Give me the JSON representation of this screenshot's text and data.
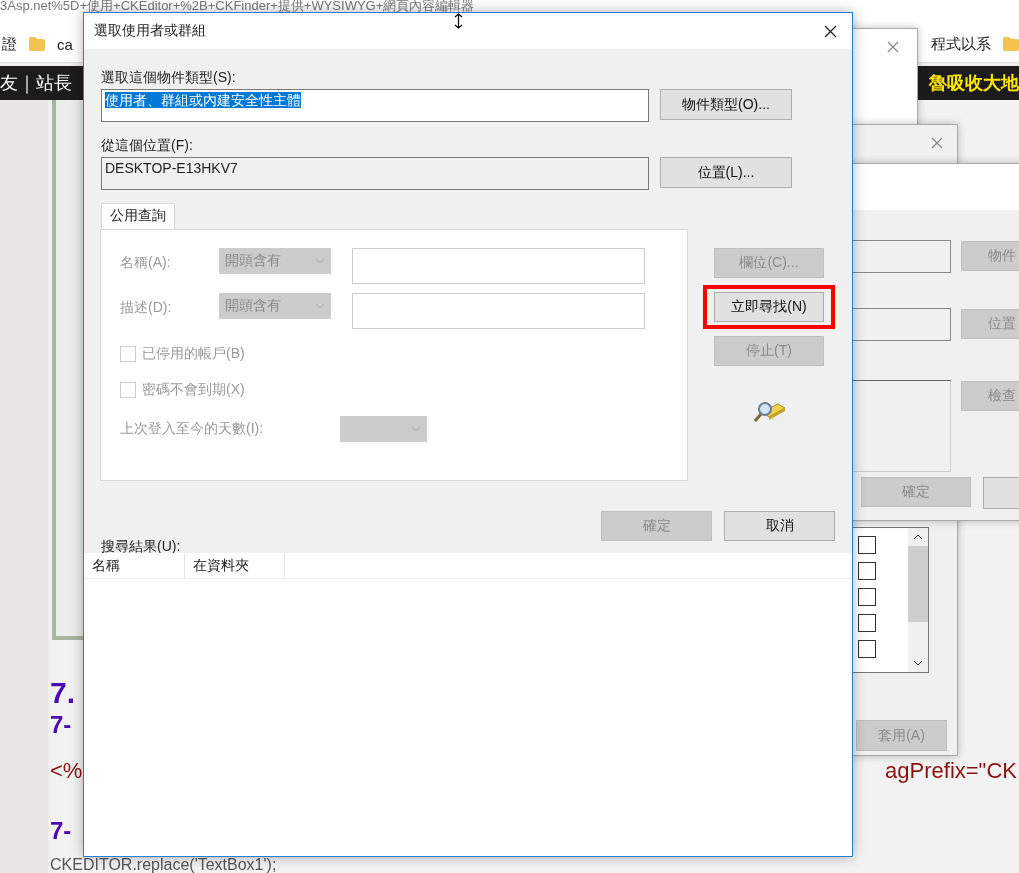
{
  "browser": {
    "address": "3Asp.net%5D+使用+CKEditor+%2B+CKFinder+提供+WYSIWYG+網頁內容編輯器",
    "bookmarks": [
      {
        "label": "證",
        "kind": "text"
      },
      {
        "label": "ca",
        "kind": "folder"
      }
    ],
    "bookmarks_right": [
      {
        "label": "程式以系",
        "kind": "text"
      },
      {
        "kind": "folder"
      }
    ],
    "nav_left": "友｜站長",
    "nav_right": "魯吸收大地",
    "article": [
      {
        "kind": "heading",
        "text": "7."
      },
      {
        "kind": "subheading",
        "text": "7-"
      },
      {
        "kind": "code",
        "text": "<%",
        "tail": "agPrefix=\"CK"
      },
      {
        "kind": "blank"
      },
      {
        "kind": "subheading",
        "text": "7-"
      },
      {
        "kind": "plain",
        "text": "CKEDITOR.replace('TextBox1');"
      }
    ]
  },
  "properties_dialog": {
    "items": [
      {
        "checked": false
      },
      {
        "checked": false
      },
      {
        "checked": false
      },
      {
        "checked": false
      },
      {
        "checked": false
      }
    ],
    "apply_button": {
      "label": "套用(A)",
      "disabled": true
    }
  },
  "permission_dialog": {
    "buttons": [
      {
        "label": "物件",
        "disabled": true
      },
      {
        "label": "位置",
        "disabled": true
      },
      {
        "label": "檢查",
        "disabled": true
      }
    ],
    "ok_button": {
      "label": "確定",
      "disabled": true
    }
  },
  "dialog": {
    "title": "選取使用者或群組",
    "object_type": {
      "label": "選取這個物件類型(S):",
      "value": "使用者、群組或內建安全性主體",
      "selected": true,
      "button": "物件類型(O)..."
    },
    "location": {
      "label": "從這個位置(F):",
      "value": "DESKTOP-E13HKV7",
      "button": "位置(L)..."
    },
    "tabs": [
      {
        "label": "公用查詢",
        "selected": true
      }
    ],
    "query_rows": [
      {
        "label": "名稱(A):",
        "mode": "開頭含有"
      },
      {
        "label": "描述(D):",
        "mode": "開頭含有"
      }
    ],
    "checkboxes": [
      {
        "label": "已停用的帳戶(B)",
        "checked": false,
        "disabled": true
      },
      {
        "label": "密碼不會到期(X)",
        "checked": false,
        "disabled": true
      }
    ],
    "days": {
      "label": "上次登入至今的天數(I):"
    },
    "side_buttons": [
      {
        "label": "欄位(C)...",
        "disabled": true,
        "highlighted": false
      },
      {
        "label": "立即尋找(N)",
        "disabled": false,
        "highlighted": true
      },
      {
        "label": "停止(T)",
        "disabled": true,
        "highlighted": false
      }
    ],
    "ok_button": {
      "label": "確定",
      "disabled": true
    },
    "cancel_button": {
      "label": "取消",
      "disabled": false
    },
    "results": {
      "label": "搜尋結果(U):",
      "columns": [
        "名稱",
        "在資料夾"
      ]
    }
  }
}
